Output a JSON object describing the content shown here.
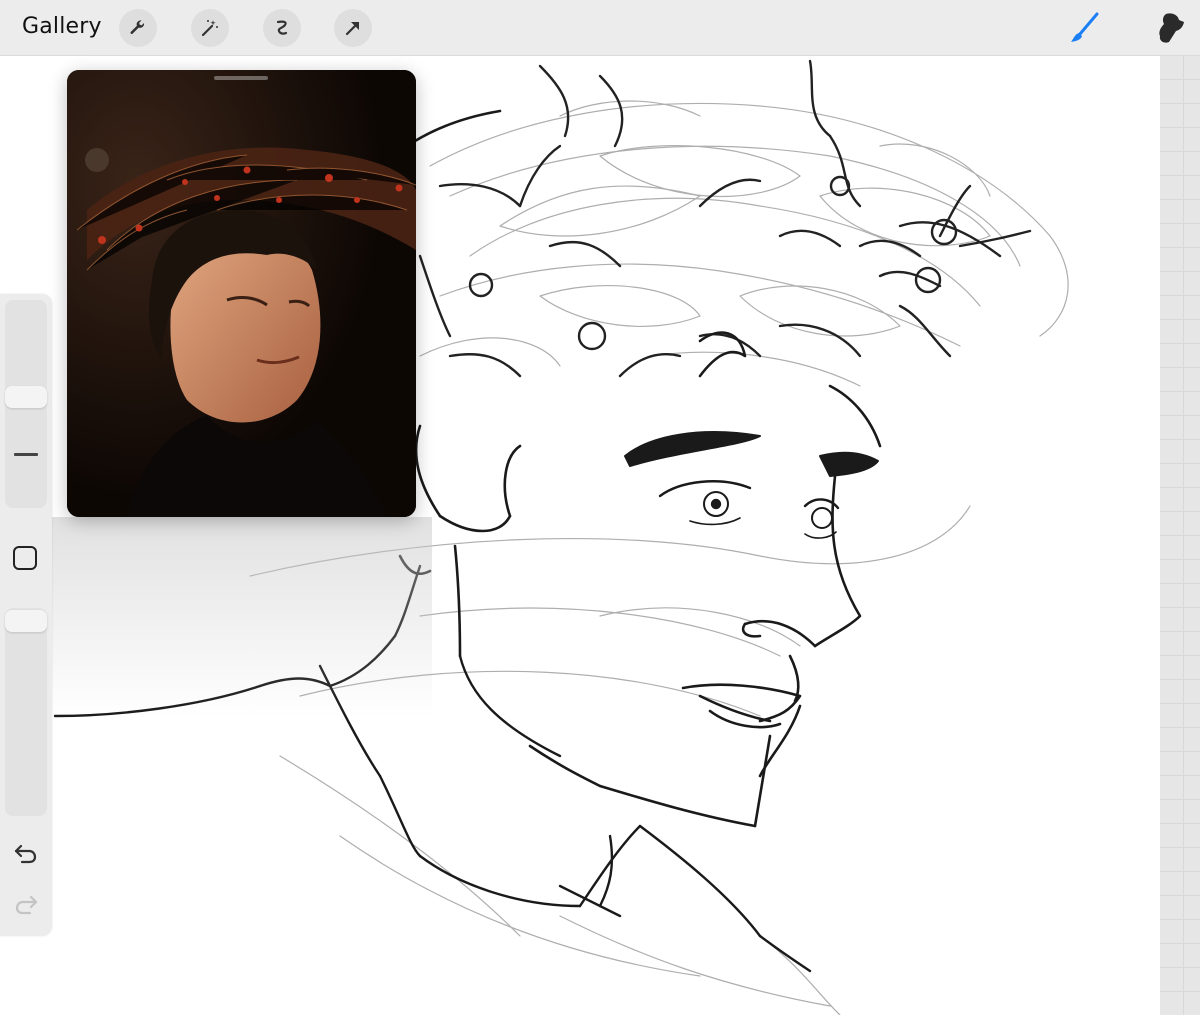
{
  "topbar": {
    "gallery_label": "Gallery",
    "tools": [
      "wrench-icon",
      "magic-wand-icon",
      "selection-icon",
      "transform-arrow-icon"
    ],
    "right_tools": [
      "brush-icon",
      "smudge-icon"
    ]
  },
  "sidebar": {
    "controls": [
      "brush-size-slider",
      "modify-button",
      "brush-opacity-slider",
      "undo-icon",
      "redo-icon"
    ]
  },
  "colors": {
    "accent": "#1b7ff5",
    "topbar": "#ececec"
  }
}
